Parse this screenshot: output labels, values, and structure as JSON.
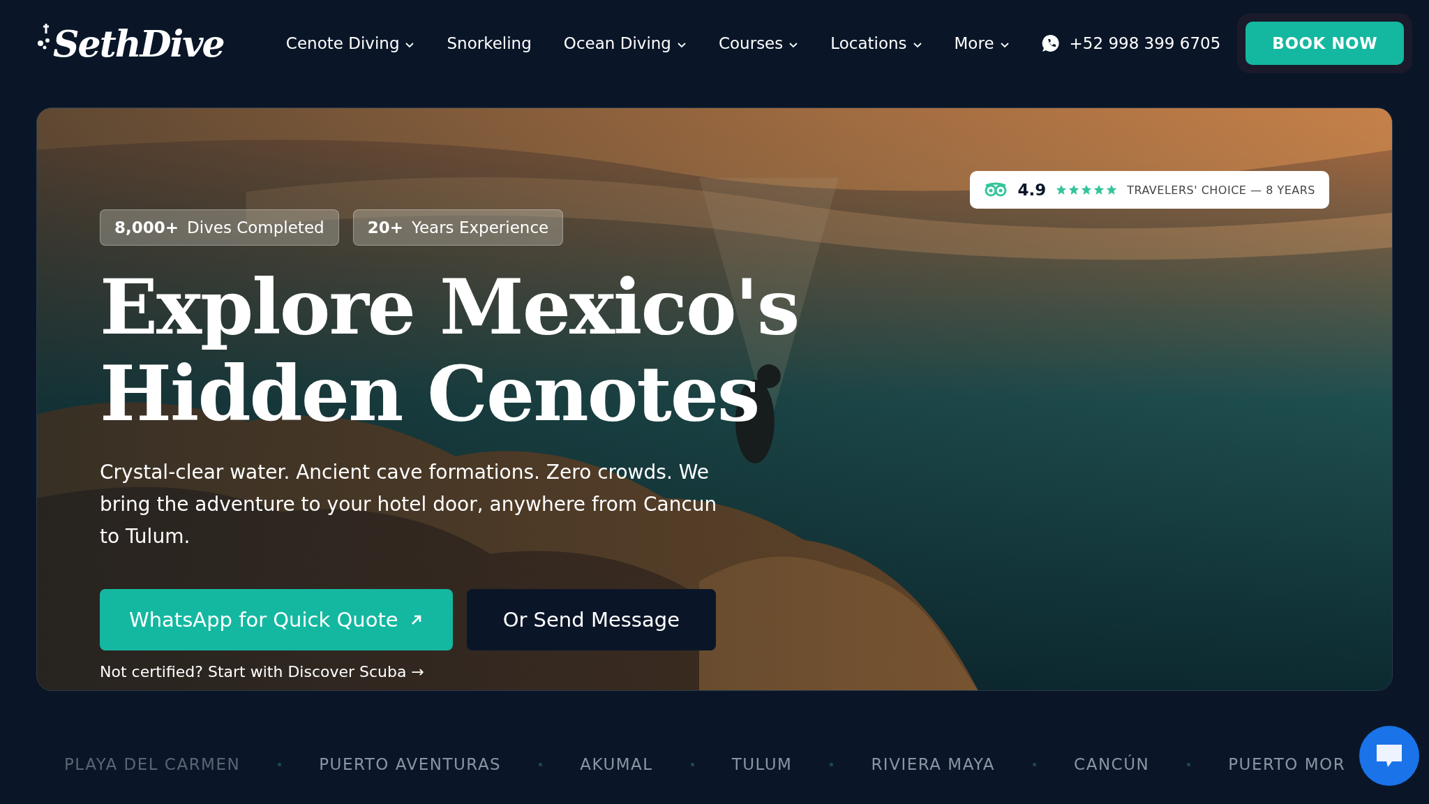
{
  "brand": {
    "logo": "SethDive"
  },
  "nav": [
    {
      "label": "Cenote Diving",
      "dropdown": true
    },
    {
      "label": "Snorkeling",
      "dropdown": false
    },
    {
      "label": "Ocean Diving",
      "dropdown": true
    },
    {
      "label": "Courses",
      "dropdown": true
    },
    {
      "label": "Locations",
      "dropdown": true
    },
    {
      "label": "More",
      "dropdown": true
    }
  ],
  "phone": "+52 998 399 6705",
  "book_button": "BOOK NOW",
  "hero": {
    "stats": [
      {
        "value": "8,000+",
        "label": "Dives Completed"
      },
      {
        "value": "20+",
        "label": "Years Experience"
      }
    ],
    "rating": {
      "score": "4.9",
      "stars": 5,
      "caption": "TRAVELERS' CHOICE — 8 YEARS"
    },
    "title_lines": [
      "Explore Mexico's",
      "Hidden Cenotes"
    ],
    "description": "Crystal-clear water. Ancient cave formations. Zero crowds. We bring the adventure to your hotel door, anywhere from Cancun to Tulum.",
    "primary_button": "WhatsApp for Quick Quote",
    "secondary_button": "Or Send Message",
    "link": "Not certified? Start with Discover Scuba →"
  },
  "locations": [
    "PLAYA DEL CARMEN",
    "PUERTO AVENTURAS",
    "AKUMAL",
    "TULUM",
    "RIVIERA MAYA",
    "CANCÚN",
    "PUERTO MOR"
  ]
}
